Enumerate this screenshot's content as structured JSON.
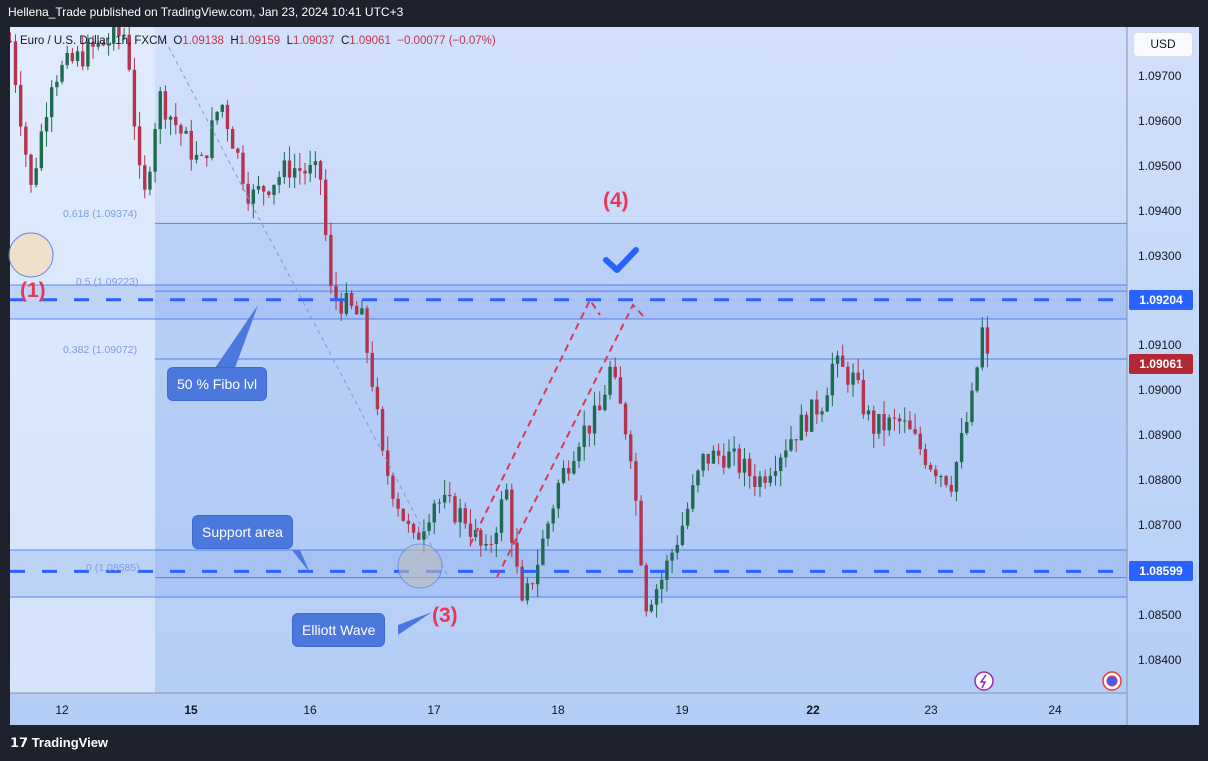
{
  "header": {
    "text": "Hellena_Trade published on TradingView.com, Jan 23, 2024 10:41 UTC+3"
  },
  "legend": {
    "symbol": "Euro / U.S. Dollar, 1h, FXCM",
    "o_label": "O",
    "o": "1.09138",
    "h_label": "H",
    "h": "1.09159",
    "l_label": "L",
    "l": "1.09037",
    "c_label": "C",
    "c": "1.09061",
    "change": "−0.00077 (−0.07%)"
  },
  "price_axis": {
    "currency": "USD",
    "ticks": [
      "1.09700",
      "1.09600",
      "1.09500",
      "1.09400",
      "1.09300",
      "1.09100",
      "1.09000",
      "1.08900",
      "1.08800",
      "1.08700",
      "1.08500",
      "1.08400"
    ],
    "tags": [
      {
        "label": "1.09204",
        "color": "#2962ff"
      },
      {
        "label": "1.09061",
        "color": "#b22833"
      },
      {
        "label": "1.08599",
        "color": "#2962ff"
      }
    ]
  },
  "time_axis": {
    "labels": [
      "12",
      "15",
      "16",
      "17",
      "18",
      "19",
      "22",
      "23",
      "24"
    ]
  },
  "fib": {
    "levels": [
      {
        "label": "0.618 (1.09374)",
        "price": 1.09374
      },
      {
        "label": "0.5 (1.09223)",
        "price": 1.09223
      },
      {
        "label": "0.382 (1.09072)",
        "price": 1.09072
      },
      {
        "label": "0 (1.08585)",
        "price": 1.08585
      }
    ]
  },
  "levels": {
    "resistance_dashed": 1.09204,
    "support_dashed": 1.08599
  },
  "annotations": {
    "fibo_callout": "50 % Fibo lvl",
    "support_callout": "Support area",
    "elliott_callout": "Elliott Wave",
    "wave1": "(1)",
    "wave3": "(3)",
    "wave4": "(4)"
  },
  "colors": {
    "up": "#1e6b4f",
    "down": "#b2344f",
    "accent": "#2962ff",
    "wave": "#e4385a"
  },
  "chart_data": {
    "type": "candlestick",
    "symbol": "EURUSD",
    "interval": "1h",
    "ylim": [
      1.0835,
      1.0985
    ],
    "price_path": [
      [
        "11 14:00",
        1.0978
      ],
      [
        "11 18:00",
        1.0945
      ],
      [
        "11 22:00",
        1.097
      ],
      [
        "12 04:00",
        1.0975
      ],
      [
        "12 12:00",
        1.098
      ],
      [
        "12 15:00",
        1.094
      ],
      [
        "12 18:00",
        1.0966
      ],
      [
        "15 02:00",
        1.095
      ],
      [
        "15 06:00",
        1.0965
      ],
      [
        "15 12:00",
        1.0943
      ],
      [
        "15 20:00",
        1.095
      ],
      [
        "16 02:00",
        1.0948
      ],
      [
        "16 04:00",
        1.0922
      ],
      [
        "16 10:00",
        1.0916
      ],
      [
        "16 12:00",
        1.0903
      ],
      [
        "16 14:00",
        1.0885
      ],
      [
        "16 20:00",
        1.0866
      ],
      [
        "17 00:00",
        1.0876
      ],
      [
        "17 06:00",
        1.0872
      ],
      [
        "17 10:00",
        1.0863
      ],
      [
        "17 14:00",
        1.0878
      ],
      [
        "17 17:00",
        1.0851
      ],
      [
        "17 20:00",
        1.0862
      ],
      [
        "18 00:00",
        1.0879
      ],
      [
        "18 04:00",
        1.089
      ],
      [
        "18 08:00",
        1.0895
      ],
      [
        "18 10:00",
        1.0905
      ],
      [
        "18 14:00",
        1.0888
      ],
      [
        "18 17:00",
        1.0853
      ],
      [
        "18 20:00",
        1.0858
      ],
      [
        "19 00:00",
        1.087
      ],
      [
        "19 04:00",
        1.0885
      ],
      [
        "19 08:00",
        1.0886
      ],
      [
        "19 14:00",
        1.088
      ],
      [
        "19 20:00",
        1.089
      ],
      [
        "22 02:00",
        1.0898
      ],
      [
        "22 04:00",
        1.0906
      ],
      [
        "22 08:00",
        1.0903
      ],
      [
        "22 12:00",
        1.0892
      ],
      [
        "22 18:00",
        1.0893
      ],
      [
        "23 00:00",
        1.0884
      ],
      [
        "23 04:00",
        1.088
      ],
      [
        "23 08:00",
        1.0898
      ],
      [
        "23 10:00",
        1.0914
      ],
      [
        "23 11:00",
        1.09061
      ]
    ]
  },
  "footer": {
    "brand": "TradingView"
  }
}
